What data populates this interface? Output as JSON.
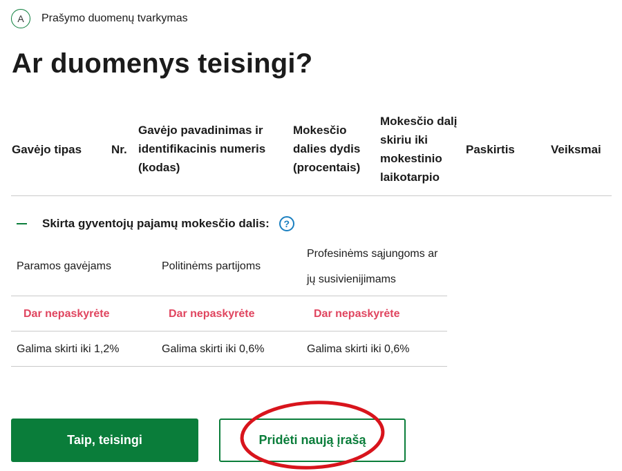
{
  "step": {
    "letter": "A",
    "label": "Prašymo duomenų tvarkymas"
  },
  "page_title": "Ar duomenys teisingi?",
  "table_headers": {
    "recipient_type": "Gavėjo tipas",
    "number": "Nr.",
    "recipient_name": "Gavėjo pavadinimas ir identifikacinis numeris (kodas)",
    "tax_share": "Mokesčio dalies dydis (procentais)",
    "period": "Mokesčio dalį skiriu iki mokestinio laikotarpio",
    "purpose": "Paskirtis",
    "actions": "Veiksmai"
  },
  "section": {
    "title": "Skirta gyventojų pajamų mokesčio dalis:",
    "help": "?",
    "columns": [
      {
        "label": "Paramos gavėjams",
        "status": "Dar nepaskyrėte",
        "limit": "Galima skirti iki 1,2%"
      },
      {
        "label": "Politinėms partijoms",
        "status": "Dar nepaskyrėte",
        "limit": "Galima skirti iki 0,6%"
      },
      {
        "label": "Profesinėms sąjungoms ar jų susivienijimams",
        "status": "Dar nepaskyrėte",
        "limit": "Galima skirti iki 0,6%"
      }
    ]
  },
  "buttons": {
    "confirm": "Taip, teisingi",
    "add_new": "Pridėti naują įrašą"
  },
  "colors": {
    "green": "#0a7d3a",
    "status_red": "#e0455f",
    "help_blue": "#1a7fc0",
    "annotation_red": "#d8141c"
  }
}
